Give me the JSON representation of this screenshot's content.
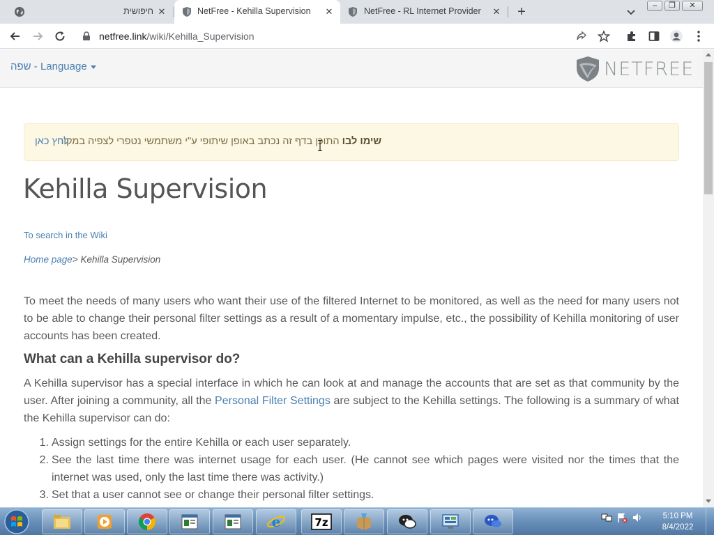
{
  "browser": {
    "tabs": [
      {
        "label": "חיפושית",
        "active": false
      },
      {
        "label": "NetFree - Kehilla Supervision",
        "active": true
      },
      {
        "label": "NetFree - RL Internet Provider",
        "active": false
      }
    ],
    "new_tab": "+",
    "close_glyph": "✕",
    "url_host": "netfree.link",
    "url_path": "/wiki/Kehilla_Supervision"
  },
  "header": {
    "language_label": "שפה - Language",
    "logo_text": "NETFREE"
  },
  "alert": {
    "bold": "שימו לבו",
    "text": " התוכן בדף זה נכתב באופן שיתופי ע\"י משתמשי נטפרי לצפיה במקור",
    "link": "לחץ כאן"
  },
  "main": {
    "title": "Kehilla Supervision",
    "search_link": "To search in the Wiki",
    "breadcrumb": {
      "home": "Home page",
      "sep": "> ",
      "current": "Kehilla Supervision"
    },
    "intro": "To meet the needs of many users who want their use of the filtered Internet to be monitored, as well as the need for many users not to be able to change their personal filter settings as a result of a momentary impulse, etc., the possibility of Kehilla monitoring of user accounts has been created.",
    "section_title": "What can a Kehilla supervisor do?",
    "section_text_1": "A Kehilla supervisor has a special interface in which he can look at and manage the accounts that are set as that community by the user. After joining a community, all the ",
    "section_link": "Personal Filter Settings",
    "section_text_2": " are subject to the Kehilla settings. The following is a summary of what the Kehilla supervisor can do:",
    "steps": [
      {
        "num": "1.",
        "text": "Assign settings for the entire Kehilla or each user separately."
      },
      {
        "num": "2.",
        "text": "See the last time there was internet usage for each user. (He cannot see which pages were visited nor the times that the internet was used, only the last time there was activity.)"
      },
      {
        "num": "3.",
        "text": "Set that a user cannot see or change their personal filter settings."
      }
    ]
  },
  "taskbar": {
    "apps": [
      "explorer-icon",
      "media-player-icon",
      "chrome-icon",
      "document-viewer-icon",
      "document-viewer-icon",
      "internet-explorer-icon",
      "7zip-icon",
      "installer-icon",
      "chat-icon",
      "control-panel-icon",
      "remote-access-icon"
    ],
    "time": "5:10 PM",
    "date": "8/4/2022"
  },
  "colors": {
    "link": "#4a7fb0",
    "alert_bg": "#fcf8e3",
    "header_bg": "#f5f5f5",
    "tabstrip_bg": "#dee1e6"
  }
}
